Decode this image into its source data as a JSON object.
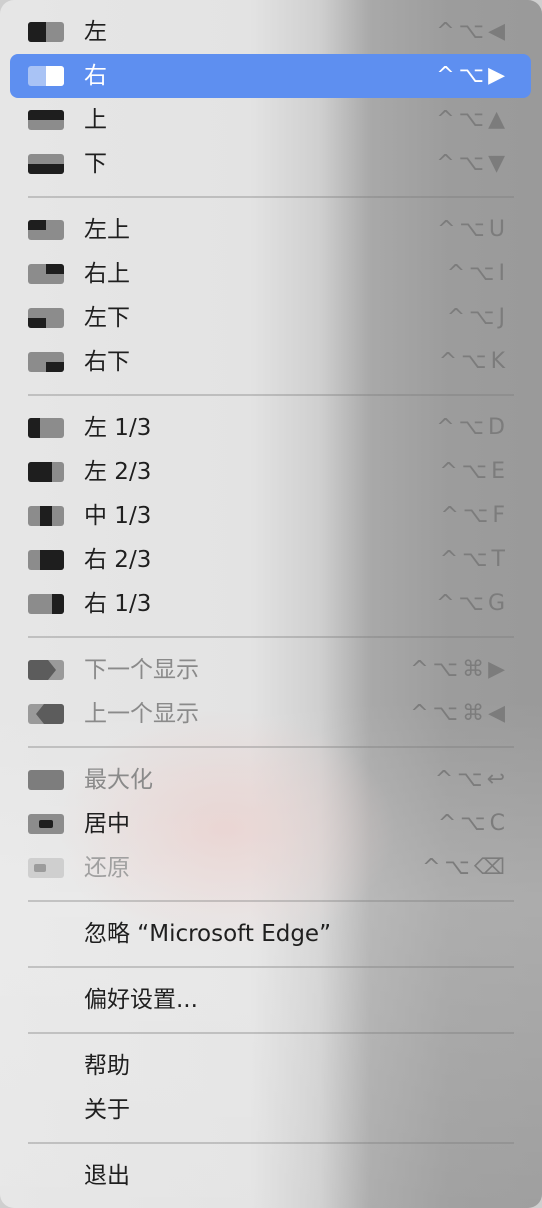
{
  "menu": {
    "items": [
      {
        "label": "左",
        "shortcut": "^⌥◀",
        "icon": "snap-left-icon"
      },
      {
        "label": "右",
        "shortcut": "^⌥▶",
        "icon": "snap-right-icon",
        "selected": true
      },
      {
        "label": "上",
        "shortcut": "^⌥▲",
        "icon": "snap-top-icon"
      },
      {
        "label": "下",
        "shortcut": "^⌥▼",
        "icon": "snap-bottom-icon"
      },
      {
        "label": "左上",
        "shortcut": "^⌥U",
        "icon": "snap-top-left-icon"
      },
      {
        "label": "右上",
        "shortcut": "^⌥I",
        "icon": "snap-top-right-icon"
      },
      {
        "label": "左下",
        "shortcut": "^⌥J",
        "icon": "snap-bottom-left-icon"
      },
      {
        "label": "右下",
        "shortcut": "^⌥K",
        "icon": "snap-bottom-right-icon"
      },
      {
        "label": "左 1/3",
        "shortcut": "^⌥D",
        "icon": "left-third-icon"
      },
      {
        "label": "左 2/3",
        "shortcut": "^⌥E",
        "icon": "left-two-thirds-icon"
      },
      {
        "label": "中 1/3",
        "shortcut": "^⌥F",
        "icon": "center-third-icon"
      },
      {
        "label": "右 2/3",
        "shortcut": "^⌥T",
        "icon": "right-two-thirds-icon"
      },
      {
        "label": "右 1/3",
        "shortcut": "^⌥G",
        "icon": "right-third-icon"
      },
      {
        "label": "下一个显示",
        "shortcut": "^⌥⌘▶",
        "icon": "next-display-icon",
        "disabled": true
      },
      {
        "label": "上一个显示",
        "shortcut": "^⌥⌘◀",
        "icon": "previous-display-icon",
        "disabled": true
      },
      {
        "label": "最大化",
        "shortcut": "^⌥↩",
        "icon": "maximize-icon",
        "disabled": true
      },
      {
        "label": "居中",
        "shortcut": "^⌥C",
        "icon": "center-icon"
      },
      {
        "label": "还原",
        "shortcut": "^⌥⌫",
        "icon": "restore-icon",
        "disabled": true
      },
      {
        "label": "忽略 “Microsoft Edge”"
      },
      {
        "label": "偏好设置..."
      },
      {
        "label": "帮助"
      },
      {
        "label": "关于"
      },
      {
        "label": "退出"
      }
    ]
  },
  "colors": {
    "selection": "#5e8ff0",
    "icon_dark": "#1e1e1e",
    "icon_light": "#8c8c8c"
  }
}
